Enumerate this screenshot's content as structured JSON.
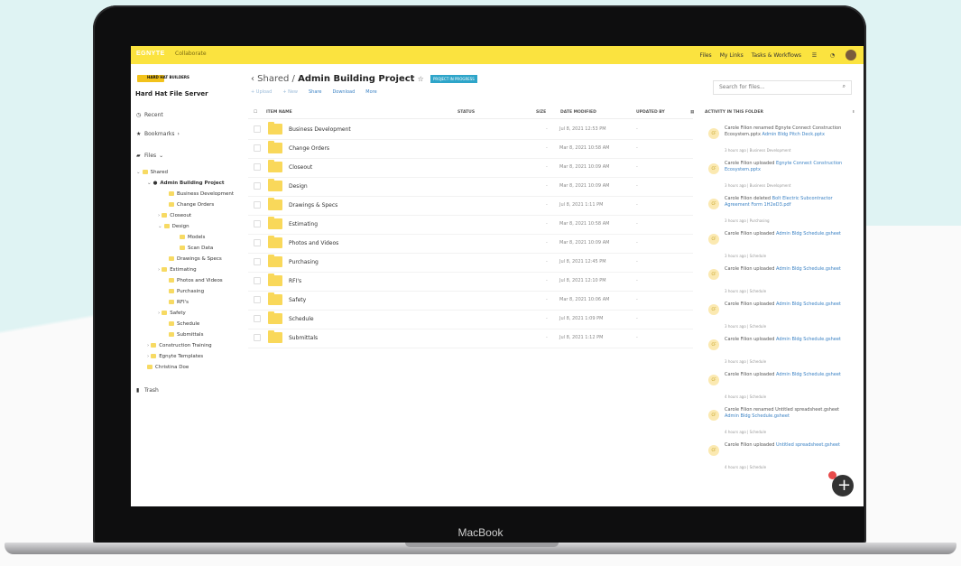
{
  "device": {
    "brand": "MacBook"
  },
  "topbar": {
    "logo": "EGNYTE",
    "subtitle": "Collaborate",
    "links": [
      "Files",
      "My Links",
      "Tasks & Workflows"
    ]
  },
  "sidebar": {
    "org_logo_text": "HARD HAT BUILDERS",
    "server_name": "Hard Hat File Server",
    "recent": "Recent",
    "bookmarks": "Bookmarks",
    "files": "Files",
    "trash": "Trash",
    "tree": [
      "Shared",
      "Admin Building Project",
      "Business Development",
      "Change Orders",
      "Closeout",
      "Design",
      "Models",
      "Scan Data",
      "Drawings & Specs",
      "Estimating",
      "Photos and Videos",
      "Purchasing",
      "RFI's",
      "Safety",
      "Schedule",
      "Submittals",
      "Construction Training",
      "Egnyte Templates",
      "Christina Doe"
    ]
  },
  "main": {
    "breadcrumb_prefix": "‹ Shared / ",
    "breadcrumb_current": "Admin Building Project",
    "badge": "PROJECT IN PROGRESS",
    "actions": [
      "+ Upload",
      "+ New",
      "Share",
      "Download",
      "More"
    ],
    "search_placeholder": "Search for files...",
    "columns": {
      "name": "ITEM NAME",
      "status": "STATUS",
      "size": "SIZE",
      "date": "DATE MODIFIED",
      "updated": "UPDATED BY"
    },
    "rows": [
      {
        "name": "Business Development",
        "size": "-",
        "date": "Jul 8, 2021 12:53 PM",
        "updated": "-"
      },
      {
        "name": "Change Orders",
        "size": "-",
        "date": "Mar 8, 2021 10:58 AM",
        "updated": "-"
      },
      {
        "name": "Closeout",
        "size": "-",
        "date": "Mar 8, 2021 10:09 AM",
        "updated": "-"
      },
      {
        "name": "Design",
        "size": "-",
        "date": "Mar 8, 2021 10:09 AM",
        "updated": "-"
      },
      {
        "name": "Drawings & Specs",
        "size": "-",
        "date": "Jul 8, 2021 1:11 PM",
        "updated": "-"
      },
      {
        "name": "Estimating",
        "size": "-",
        "date": "Mar 8, 2021 10:58 AM",
        "updated": "-"
      },
      {
        "name": "Photos and Videos",
        "size": "-",
        "date": "Mar 8, 2021 10:09 AM",
        "updated": "-"
      },
      {
        "name": "Purchasing",
        "size": "-",
        "date": "Jul 8, 2021 12:45 PM",
        "updated": "-"
      },
      {
        "name": "RFI's",
        "size": "-",
        "date": "Jul 8, 2021 12:10 PM",
        "updated": "-"
      },
      {
        "name": "Safety",
        "size": "-",
        "date": "Mar 8, 2021 10:06 AM",
        "updated": "-"
      },
      {
        "name": "Schedule",
        "size": "-",
        "date": "Jul 8, 2021 1:09 PM",
        "updated": "-"
      },
      {
        "name": "Submittals",
        "size": "-",
        "date": "Jul 8, 2021 1:12 PM",
        "updated": "-"
      }
    ]
  },
  "activity": {
    "title": "ACTIVITY IN THIS FOLDER",
    "items": [
      {
        "initials": "CF",
        "text": "Carole Filion renamed Egnyte Connect Construction Ecosystem.pptx",
        "link": "Admin Bldg Pitch Deck.pptx",
        "meta": "3 hours ago  |  Business Development"
      },
      {
        "initials": "CF",
        "text": "Carole Filion uploaded",
        "link": "Egnyte Connect Construction Ecosystem.pptx",
        "meta": "3 hours ago  |  Business Development"
      },
      {
        "initials": "CF",
        "text": "Carole Filion deleted",
        "link": "Bolt Electric Subcontractor Agreement Form 1H2eD3.pdf",
        "meta": "3 hours ago  |  Purchasing"
      },
      {
        "initials": "CF",
        "text": "Carole Filion uploaded",
        "link": "Admin Bldg Schedule.gsheet",
        "meta": "3 hours ago  |  Schedule"
      },
      {
        "initials": "CF",
        "text": "Carole Filion uploaded",
        "link": "Admin Bldg Schedule.gsheet",
        "meta": "3 hours ago  |  Schedule"
      },
      {
        "initials": "CF",
        "text": "Carole Filion uploaded",
        "link": "Admin Bldg Schedule.gsheet",
        "meta": "3 hours ago  |  Schedule"
      },
      {
        "initials": "CF",
        "text": "Carole Filion uploaded",
        "link": "Admin Bldg Schedule.gsheet",
        "meta": "3 hours ago  |  Schedule"
      },
      {
        "initials": "CF",
        "text": "Carole Filion uploaded",
        "link": "Admin Bldg Schedule.gsheet",
        "meta": "4 hours ago  |  Schedule"
      },
      {
        "initials": "CF",
        "text": "Carole Filion renamed Untitled spreadsheet.gsheet",
        "link": "Admin Bldg Schedule.gsheet",
        "meta": "4 hours ago  |  Schedule"
      },
      {
        "initials": "CF",
        "text": "Carole Filion uploaded",
        "link": "Untitled spreadsheet.gsheet",
        "meta": "4 hours ago  |  Schedule"
      }
    ]
  }
}
